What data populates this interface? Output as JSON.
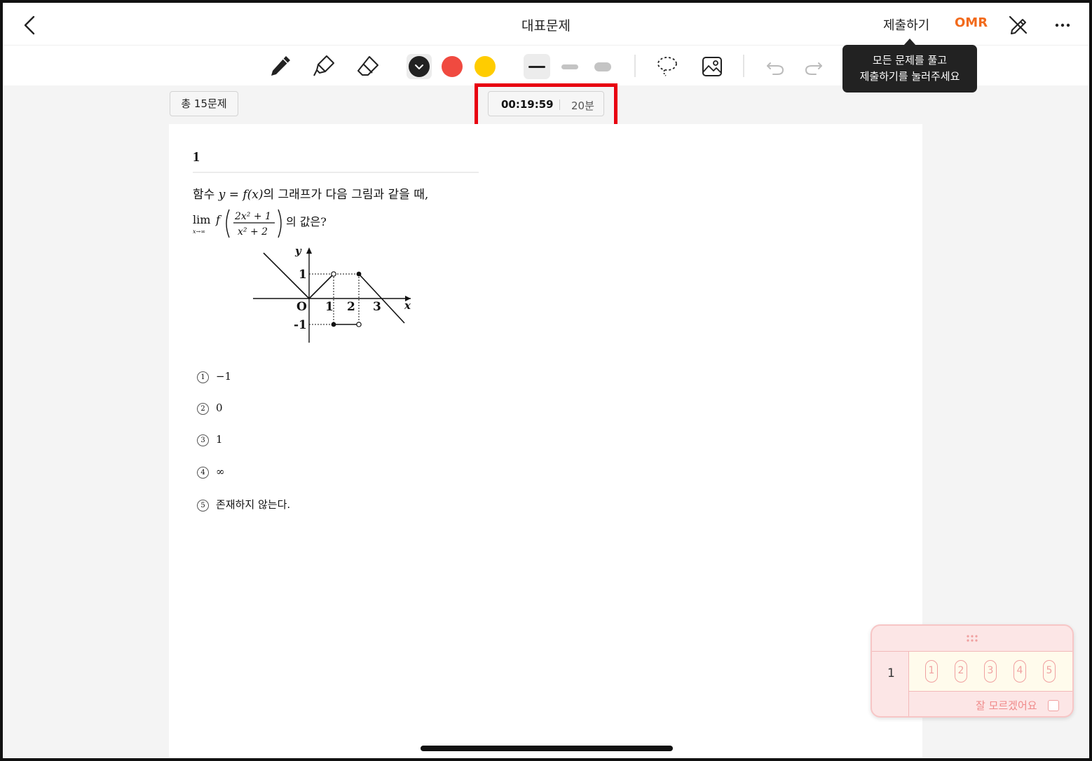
{
  "header": {
    "title": "대표문제",
    "submit_label": "제출하기",
    "omr_label": "OMR",
    "icons": [
      "chevron-left-icon",
      "pen-off-icon",
      "more-icon"
    ]
  },
  "toolbar": {
    "tools": [
      "pencil-icon",
      "highlighter-icon",
      "eraser-icon",
      "lasso-icon",
      "image-icon",
      "undo-icon",
      "redo-icon"
    ],
    "colors": [
      "#222222",
      "#f04a40",
      "#ffcc00"
    ],
    "selected_color": "#222222",
    "stroke_widths": [
      "thin",
      "medium",
      "thick"
    ],
    "selected_stroke": "thin"
  },
  "tooltip": {
    "line1": "모든 문제를 풀고",
    "line2": "제출하기를 눌러주세요"
  },
  "status": {
    "question_count": "총 15문제",
    "timer_elapsed": "00:19:59",
    "timer_limit": "20분"
  },
  "question": {
    "number": "1",
    "text_prefix": "함수 ",
    "text_formula": "y = f(x)",
    "text_suffix": "의 그래프가 다음 그림과 같을 때,",
    "limit_word": "lim",
    "limit_sub": "x→∞",
    "func": "f",
    "numerator": "2x² + 1",
    "denominator": "x² + 2",
    "limit_suffix": "의 값은?",
    "graph_labels": {
      "y": "y",
      "x": "x",
      "origin": "O",
      "one": "1",
      "two": "2",
      "three": "3",
      "y_one": "1",
      "y_neg_one": "-1"
    },
    "choices": [
      {
        "mark": "1",
        "text": "−1"
      },
      {
        "mark": "2",
        "text": "0"
      },
      {
        "mark": "3",
        "text": "1"
      },
      {
        "mark": "4",
        "text": "∞"
      },
      {
        "mark": "5",
        "text": "존재하지 않는다."
      }
    ]
  },
  "omr": {
    "question_number": "1",
    "options": [
      "1",
      "2",
      "3",
      "4",
      "5"
    ],
    "unsure_label": "잘 모르겠어요"
  }
}
